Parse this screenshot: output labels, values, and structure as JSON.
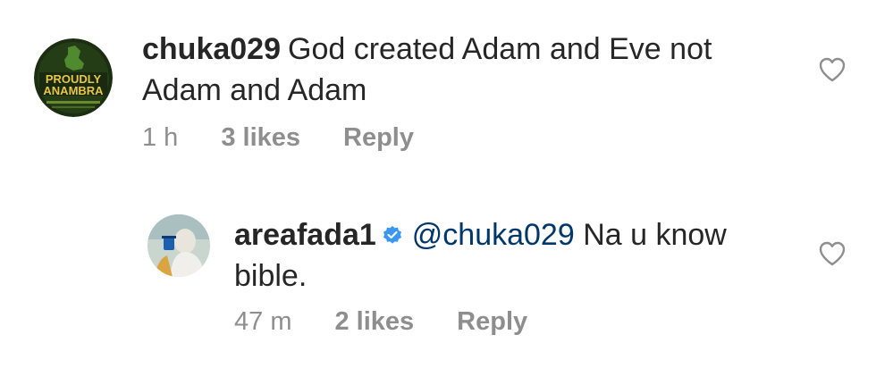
{
  "comments": [
    {
      "username": "chuka029",
      "text": "God created Adam and Eve not",
      "text_line2": "Adam and Adam",
      "time": "1 h",
      "likes": "3 likes",
      "reply": "Reply",
      "avatar": {
        "line1": "PROUDLY",
        "line2": "ANAMBRA",
        "colors": {
          "bg": "#1f3a14",
          "text": "#e7c64a",
          "ring": "#6a8a2c"
        }
      },
      "like_icon": "heart-outline-icon"
    },
    {
      "username": "areafada1",
      "verified": true,
      "verified_icon": "verified-badge-icon",
      "mention": "@chuka029",
      "text": "Na u know",
      "text_line2": "bible.",
      "time": "47 m",
      "likes": "2 likes",
      "reply": "Reply",
      "like_icon": "heart-outline-icon"
    }
  ],
  "colors": {
    "text": "#262626",
    "secondary": "#8e8e8e",
    "mention": "#00376b",
    "verified": "#3897f0"
  }
}
